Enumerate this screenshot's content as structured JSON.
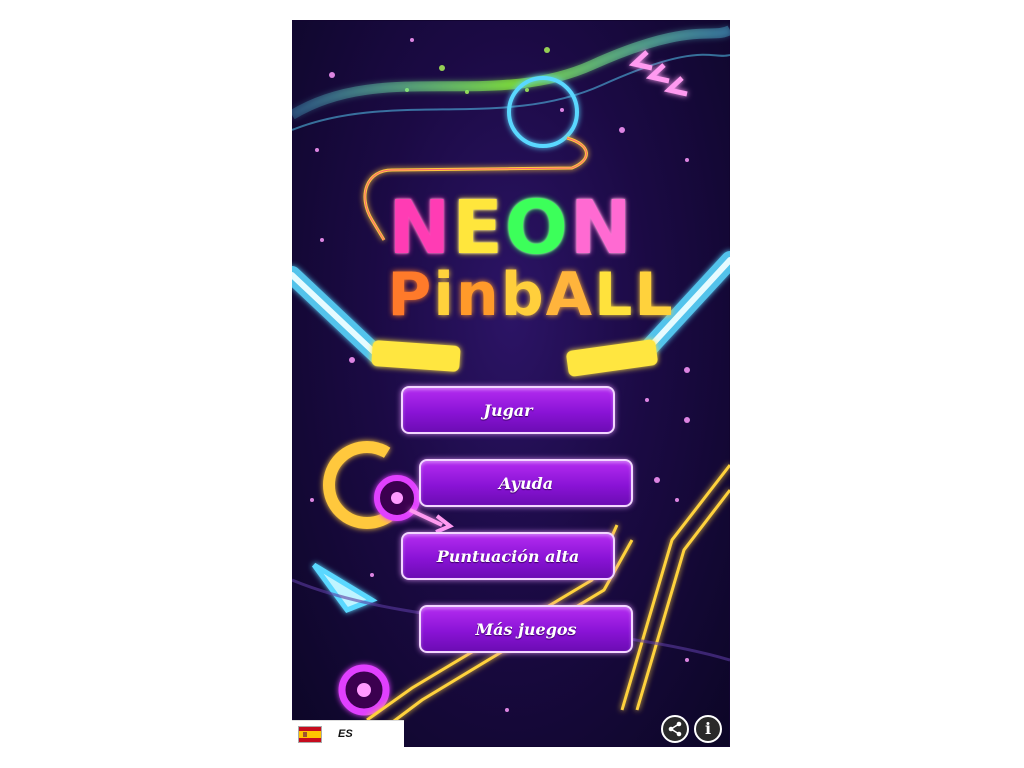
{
  "app": {
    "title_line1": [
      "N",
      "E",
      "O",
      "N"
    ],
    "title_line2": [
      "P",
      "i",
      "n",
      "b",
      "A",
      "L",
      "L"
    ],
    "title_colors_line1": [
      "#ff3cb4",
      "#ffe63c",
      "#3cff5a",
      "#ff6ad2"
    ],
    "title_colors_line2": [
      "#ff7a2a",
      "#ffd23c",
      "#ff9a2a",
      "#ffcf3c",
      "#ffb43c",
      "#ffe23c",
      "#ffd23c"
    ]
  },
  "menu": {
    "play_label": "Jugar",
    "help_label": "Ayuda",
    "highscore_label": "Puntuación alta",
    "more_games_label": "Más juegos"
  },
  "footer": {
    "language_code": "ES",
    "flag_icon": "spain-flag-icon",
    "share_icon": "share-icon",
    "info_icon": "info-icon"
  },
  "colors": {
    "button_gradient_top": "#b42cf0",
    "button_gradient_bottom": "#6c0cb4",
    "button_border": "#f2d6ff",
    "background_dark": "#1b0a44",
    "neon_cyan": "#5ad8ff",
    "neon_yellow": "#ffe640",
    "neon_magenta": "#e040ff",
    "neon_green": "#8cff3a"
  }
}
